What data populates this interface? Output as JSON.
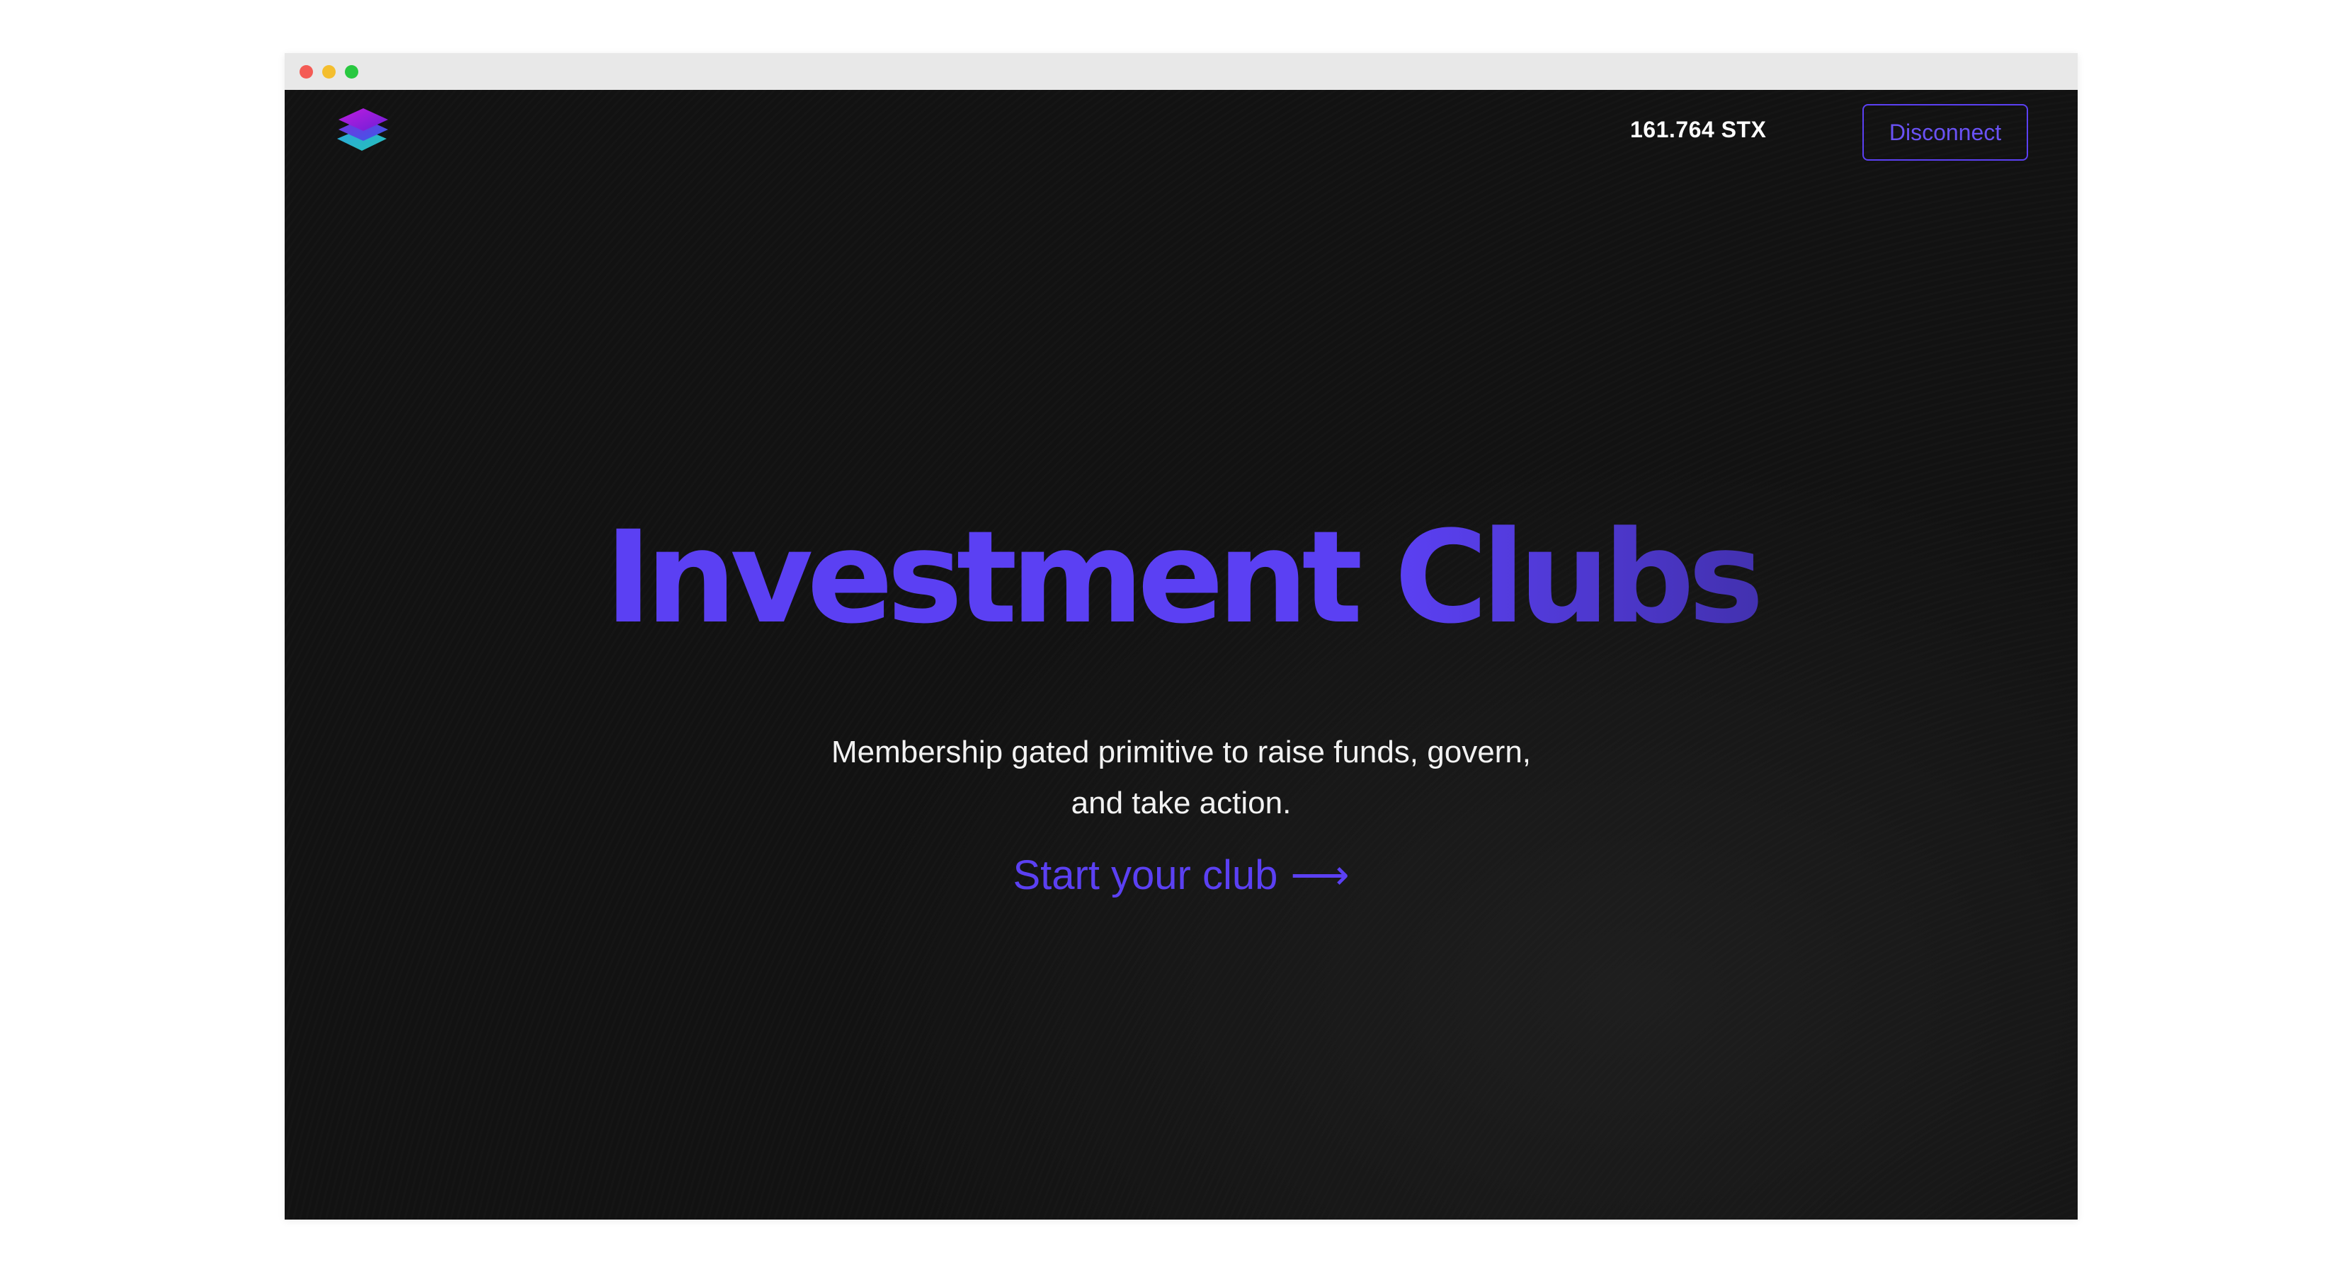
{
  "window": {
    "controls": [
      "close",
      "minimize",
      "maximize"
    ]
  },
  "header": {
    "logo_icon": "stacked-layers-logo-icon",
    "balance": "161.764 STX",
    "disconnect_label": "Disconnect"
  },
  "hero": {
    "title": "Investment Clubs",
    "subtitle_line1": "Membership gated primitive to raise funds, govern,",
    "subtitle_line2": "and take action.",
    "cta_label": "Start your club",
    "cta_arrow": "⟶"
  },
  "colors": {
    "accent": "#5b40f3",
    "background": "#121212",
    "text": "#ffffff"
  }
}
